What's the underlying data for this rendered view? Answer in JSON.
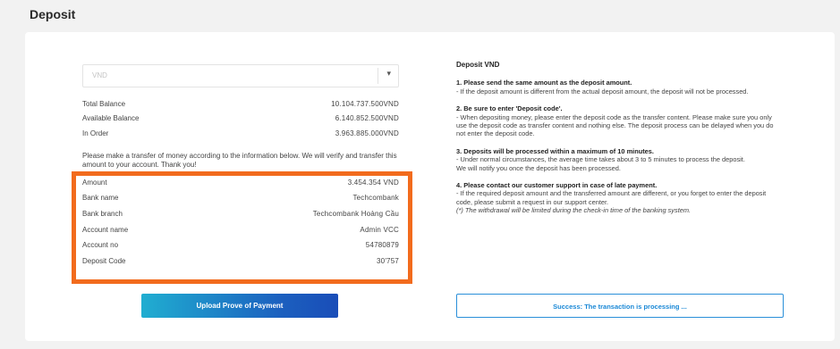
{
  "page": {
    "title": "Deposit"
  },
  "currency_select": {
    "value": "VND"
  },
  "balances": [
    {
      "label": "Total Balance",
      "value": "10.104.737.500VND"
    },
    {
      "label": "Available Balance",
      "value": "6.140.852.500VND"
    },
    {
      "label": "In Order",
      "value": "3.963.885.000VND"
    }
  ],
  "transfer_note": "Please make a transfer of money according to the information below. We will verify and transfer this amount to your account. Thank you!",
  "deposit_info": [
    {
      "label": "Amount",
      "value": "3.454.354 VND"
    },
    {
      "label": "Bank name",
      "value": "Techcombank"
    },
    {
      "label": "Bank branch",
      "value": "Techcombank Hoàng Cầu"
    },
    {
      "label": "Account name",
      "value": "Admin VCC"
    },
    {
      "label": "Account no",
      "value": "54780879"
    },
    {
      "label": "Deposit Code",
      "value": "30'757"
    }
  ],
  "upload_button": {
    "label": "Upload Prove of  Payment"
  },
  "instructions": {
    "heading": "Deposit VND",
    "steps": [
      {
        "title": "1. Please send the same amount as the deposit amount.",
        "lines": [
          "- If the deposit amount is different from the actual deposit amount, the deposit will not be processed."
        ]
      },
      {
        "title": "2. Be sure to enter 'Deposit code'.",
        "lines": [
          "- When depositing money, please enter the deposit code as the transfer content. Please make sure you only use the deposit code as transfer content and nothing else. The deposit process can be delayed when you do not enter the deposit code."
        ]
      },
      {
        "title": "3. Deposits will be processed within a maximum of 10 minutes.",
        "lines": [
          "- Under normal circumstances, the average time takes about 3 to 5 minutes to process the deposit.",
          "We will notify you once the deposit has been processed."
        ]
      },
      {
        "title": "4. Please contact our customer support in case of late payment.",
        "lines": [
          "- If the required deposit amount and the transferred amount are different, or you forget to enter the deposit code, please submit a request in our support center."
        ]
      }
    ],
    "footnote": "(*) The withdrawal will be limited during the check-in time of the banking system."
  },
  "status": {
    "message": "Success: The transaction is processing ..."
  },
  "colors": {
    "highlight": "#f26b1d",
    "accent": "#1a88d6"
  }
}
